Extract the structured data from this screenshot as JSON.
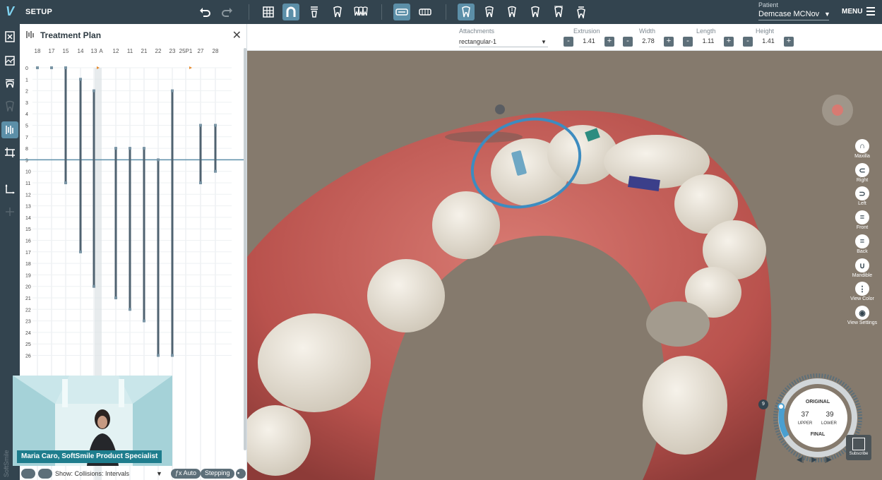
{
  "header": {
    "section": "SETUP",
    "patient_label": "Patient",
    "patient_name": "Demcase MCNov",
    "menu_label": "MENU"
  },
  "panel": {
    "title": "Treatment Plan",
    "teeth": [
      "18",
      "17",
      "15",
      "14",
      "13",
      "A",
      "12",
      "11",
      "21",
      "22",
      "23",
      "25P1",
      "27",
      "28"
    ],
    "stage_rows": [
      "0",
      "1",
      "2",
      "3",
      "4",
      "5",
      "7",
      "8",
      "9",
      "10",
      "11",
      "12",
      "13",
      "14",
      "15",
      "16",
      "17",
      "18",
      "19",
      "20",
      "21",
      "22",
      "23",
      "24",
      "25",
      "26"
    ],
    "current_stage": "9",
    "footer": {
      "show_label": "Show: Collisions: Intervals",
      "auto_label": "Auto",
      "stepping_label": "Stepping"
    }
  },
  "chart_data": {
    "type": "table",
    "title": "Treatment Plan",
    "columns": [
      "18",
      "17",
      "15",
      "14",
      "13",
      "12",
      "11",
      "21",
      "22",
      "23",
      "25",
      "27",
      "28"
    ],
    "movements": [
      {
        "tooth": "15",
        "start": 0,
        "end": 11
      },
      {
        "tooth": "14",
        "start": 1,
        "end": 17
      },
      {
        "tooth": "13",
        "start": 2,
        "end": 20
      },
      {
        "tooth": "12",
        "start": 8,
        "end": 21
      },
      {
        "tooth": "11",
        "start": 8,
        "end": 22
      },
      {
        "tooth": "21",
        "start": 8,
        "end": 23
      },
      {
        "tooth": "22",
        "start": 9,
        "end": 26
      },
      {
        "tooth": "23",
        "start": 2,
        "end": 26
      },
      {
        "tooth": "27",
        "start": 5,
        "end": 11
      },
      {
        "tooth": "28",
        "start": 5,
        "end": 10
      }
    ]
  },
  "webcam": {
    "caption": "Maria Caro, SoftSmile Product Specialist"
  },
  "attachments": {
    "attachments_label": "Attachments",
    "type_value": "rectangular-1",
    "extrusion_label": "Extrusion",
    "extrusion_value": "1.41",
    "width_label": "Width",
    "width_value": "2.78",
    "length_label": "Length",
    "length_value": "1.11",
    "height_label": "Height",
    "height_value": "1.41"
  },
  "view_buttons": [
    {
      "label": "Maxilla",
      "glyph": "∩"
    },
    {
      "label": "Right",
      "glyph": "⊂"
    },
    {
      "label": "Left",
      "glyph": "⊃"
    },
    {
      "label": "Front",
      "glyph": "≡"
    },
    {
      "label": "Back",
      "glyph": "≡"
    },
    {
      "label": "Mandible",
      "glyph": "∪"
    },
    {
      "label": "View Color",
      "glyph": "⋮"
    },
    {
      "label": "View Settings",
      "glyph": "◉"
    }
  ],
  "dial": {
    "original_label": "ORIGINAL",
    "upper_count": "37",
    "lower_count": "39",
    "upper_label": "UPPER",
    "lower_label": "LOWER",
    "final_label": "FINAL",
    "step_badge": "9"
  },
  "subscribe_label": "Subscribe",
  "colors": {
    "toolbar": "#33444f",
    "accent": "#5c8fa8",
    "viewport_bg": "#857a6d",
    "gum": "#c9655f",
    "tooth": "#e9e3d9"
  }
}
